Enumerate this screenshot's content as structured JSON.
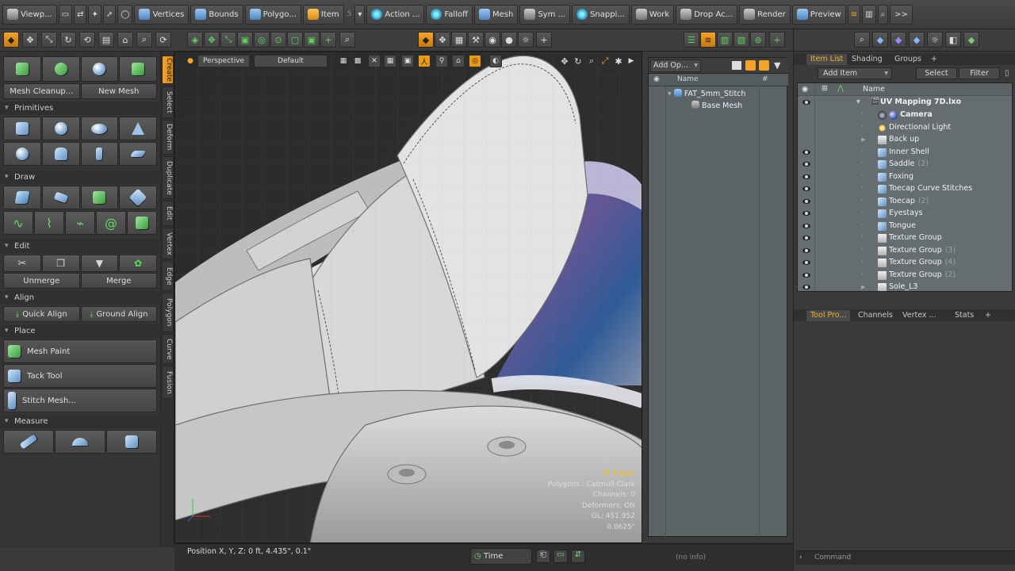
{
  "topbar": {
    "items": [
      {
        "label": "Viewp...",
        "icon": "viewport-icon"
      },
      {
        "label": "Vertices",
        "icon": "vertex-cube-icon"
      },
      {
        "label": "Bounds",
        "icon": "bounds-cube-icon"
      },
      {
        "label": "Polygo...",
        "icon": "polygon-cube-icon"
      },
      {
        "label": "Item",
        "icon": "item-cube-icon"
      },
      {
        "label": "Action ...",
        "icon": "action-center-icon"
      },
      {
        "label": "Falloff",
        "icon": "falloff-icon"
      },
      {
        "label": "Mesh",
        "icon": "mesh-icon"
      },
      {
        "label": "Sym ...",
        "icon": "symmetry-icon"
      },
      {
        "label": "Snappi...",
        "icon": "snapping-icon"
      },
      {
        "label": "Work",
        "icon": "workplane-icon"
      },
      {
        "label": "Drop Ac...",
        "icon": "drop-action-icon"
      },
      {
        "label": "Render",
        "icon": "render-icon"
      },
      {
        "label": "Preview",
        "icon": "preview-icon"
      }
    ],
    "item_count_badge": "5",
    "more_label": ">>"
  },
  "left": {
    "mesh_cleanup": "Mesh Cleanup...",
    "new_mesh": "New Mesh",
    "sections": {
      "primitives": "Primitives",
      "draw": "Draw",
      "edit": "Edit",
      "align": "Align",
      "place": "Place",
      "measure": "Measure"
    },
    "unmerge": "Unmerge",
    "merge": "Merge",
    "quick_align": "Quick Align",
    "ground_align": "Ground Align",
    "mesh_paint": "Mesh Paint",
    "tack_tool": "Tack Tool",
    "stitch_mesh": "Stitch Mesh..."
  },
  "vtabs": [
    "Create",
    "Select",
    "Deform",
    "Duplicate",
    "Edit",
    "Vertex",
    "Edge",
    "Polygon",
    "Curve",
    "Fusion"
  ],
  "viewport": {
    "view_label": "Perspective",
    "style_label": "Default",
    "info": {
      "all_edges": "All Edges",
      "polygons": "Polygons : Catmull-Clark",
      "channels": "Channels: 0",
      "deformers": "Deformers: ON",
      "gl": "GL: 451,952",
      "scale": "0.0625\""
    }
  },
  "midpanel": {
    "add_op": "Add Op...",
    "col_name": "Name",
    "col_hash": "#",
    "tree": [
      {
        "label": "FAT_5mm_Stitch"
      },
      {
        "label": "Base Mesh"
      }
    ]
  },
  "right": {
    "tabs": [
      "Item List",
      "Shading",
      "Groups",
      "+"
    ],
    "add_item": "Add Item",
    "select": "Select",
    "filter": "Filter",
    "col_name": "Name",
    "scene": "UV Mapping 7D.lxo",
    "items": [
      {
        "label": "Camera",
        "count": "",
        "eye": false,
        "bold": true,
        "type": "camera"
      },
      {
        "label": "Directional Light",
        "count": "",
        "eye": false,
        "type": "light"
      },
      {
        "label": "Back up",
        "count": "",
        "eye": false,
        "type": "folder",
        "expand": true
      },
      {
        "label": "Inner Shell",
        "count": "",
        "eye": true,
        "type": "mesh"
      },
      {
        "label": "Saddle",
        "count": "(2)",
        "eye": true,
        "type": "mesh"
      },
      {
        "label": "Foxing",
        "count": "",
        "eye": true,
        "type": "mesh"
      },
      {
        "label": "Toecap Curve Stitches",
        "count": "",
        "eye": true,
        "type": "mesh"
      },
      {
        "label": "Toecap",
        "count": "(2)",
        "eye": true,
        "type": "mesh"
      },
      {
        "label": "Eyestays",
        "count": "",
        "eye": true,
        "type": "mesh"
      },
      {
        "label": "Tongue",
        "count": "",
        "eye": true,
        "type": "mesh"
      },
      {
        "label": "Texture Group",
        "count": "",
        "eye": true,
        "type": "folder"
      },
      {
        "label": "Texture Group",
        "count": "(3)",
        "eye": true,
        "type": "folder"
      },
      {
        "label": "Texture Group",
        "count": "(4)",
        "eye": true,
        "type": "folder"
      },
      {
        "label": "Texture Group",
        "count": "(2)",
        "eye": true,
        "type": "folder"
      },
      {
        "label": "Sole_L3",
        "count": "",
        "eye": true,
        "type": "folder",
        "expand": true
      }
    ],
    "lower_tabs": [
      "Tool Pro...",
      "Channels",
      "Vertex ...",
      "Stats",
      "+"
    ],
    "command_placeholder": "Command"
  },
  "status": {
    "position": "Position X, Y, Z:   0 ft, 4.435\", 0.1\"",
    "time": "Time",
    "no_info": "(no info)"
  },
  "colors": {
    "accent": "#f3a328",
    "panel": "#3a3a3a",
    "list_bg": "#666d70"
  }
}
